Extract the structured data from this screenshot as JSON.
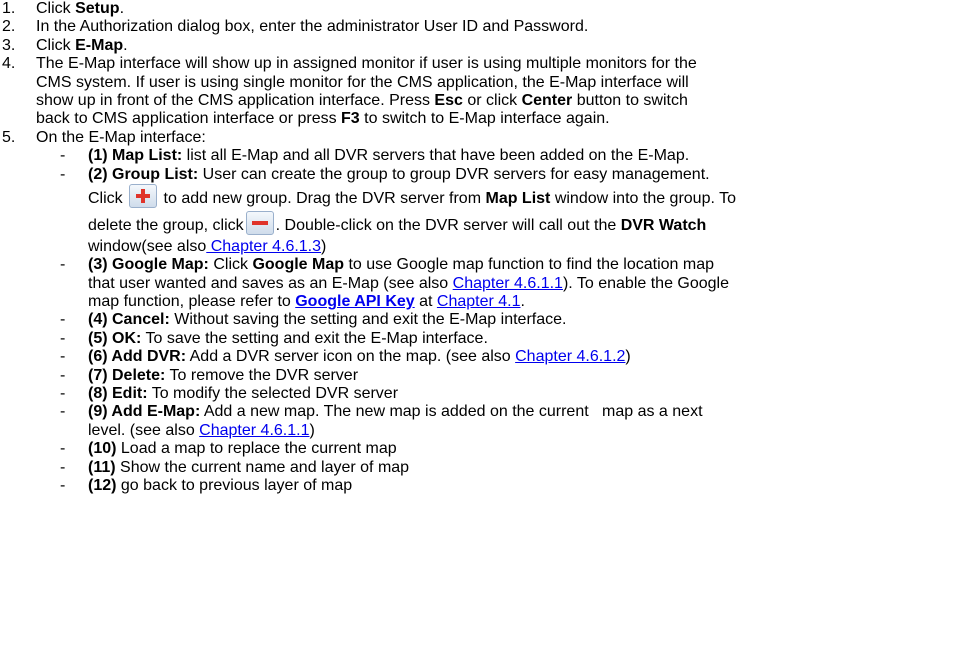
{
  "steps": [
    {
      "num": "1.",
      "pre": "Click ",
      "bold": "Setup",
      "post": "."
    },
    {
      "num": "2.",
      "text": "In the Authorization dialog box, enter the administrator User ID and Password."
    },
    {
      "num": "3.",
      "pre": "Click ",
      "bold": "E-Map",
      "post": "."
    },
    {
      "num": "4.",
      "l1": "The E-Map interface will show up in assigned monitor if user is using multiple monitors for the",
      "l2": "CMS system. If user is using single monitor for the CMS application, the E-Map interface will",
      "l3": "show up in front of the CMS application interface. Press ",
      "b1": "Esc",
      "l3b": " or click ",
      "b2": "Center",
      "l3c": " button to switch",
      "l4": "back to CMS application interface or press ",
      "b3": "F3",
      "l4b": " to switch to E-Map interface again."
    },
    {
      "num": "5.",
      "text": "On the E-Map interface:"
    }
  ],
  "dash": "-",
  "items": {
    "map_list": {
      "label": "(1) Map List:",
      "text": " list all E-Map and all DVR servers that have been added on the E-Map."
    },
    "group_list": {
      "label": "(2) Group List:",
      "t1": " User can create the group to group DVR servers for easy management.",
      "t2": "Click ",
      "t3": " to add new group. Drag the DVR server from ",
      "b_map_list": "Map List",
      "t4": " window into the group. To",
      "t5": "delete the group, click",
      "t6": ". Double-click on the DVR server will call out the ",
      "b_dvr_watch": "DVR Watch",
      "t7": "window(see also",
      "link": " Chapter 4.6.1.3",
      "t8": ")"
    },
    "google_map": {
      "label": "(3) Google Map:",
      "t1": " Click ",
      "b1": "Google Map",
      "t2": " to use Google map function to find the location map",
      "t3": "that user wanted and saves as an E-Map (see also ",
      "link1": "Chapter 4.6.1.1",
      "t4": "). To enable the Google",
      "t5": "map function, please refer to ",
      "link2": "Google API Key",
      "t6": " at ",
      "link3": "Chapter 4.1",
      "t7": "."
    },
    "cancel": {
      "label": "(4) Cancel:",
      "text": " Without saving the setting and exit the E-Map interface."
    },
    "ok": {
      "label": "(5) OK:",
      "text": " To save the setting and exit the E-Map interface."
    },
    "add_dvr": {
      "label": "(6) Add DVR:",
      "text": " Add a DVR server icon on the map. (see also ",
      "link": "Chapter 4.6.1.2",
      "post": ")"
    },
    "delete": {
      "label": "(7) Delete:",
      "text": " To remove the DVR server"
    },
    "edit": {
      "label": "(8) Edit:",
      "text": " To modify the selected DVR server"
    },
    "add_emap": {
      "label": "(9) Add E-Map:",
      "t1": " Add a new map. The new map is added on the current   map as a next",
      "t2": "level. (see also ",
      "link": "Chapter 4.6.1.1",
      "t3": ")"
    },
    "load": {
      "label": "(10)",
      "text": " Load a map to replace the current map"
    },
    "show": {
      "label": "(11)",
      "text": " Show the current name and layer of map"
    },
    "back": {
      "label": "(12)",
      "text": " go back to previous layer of map"
    }
  },
  "icons": {
    "add": "plus-icon",
    "remove": "minus-icon"
  },
  "colors": {
    "link": "#0000ee",
    "icon_red": "#e0342b"
  }
}
